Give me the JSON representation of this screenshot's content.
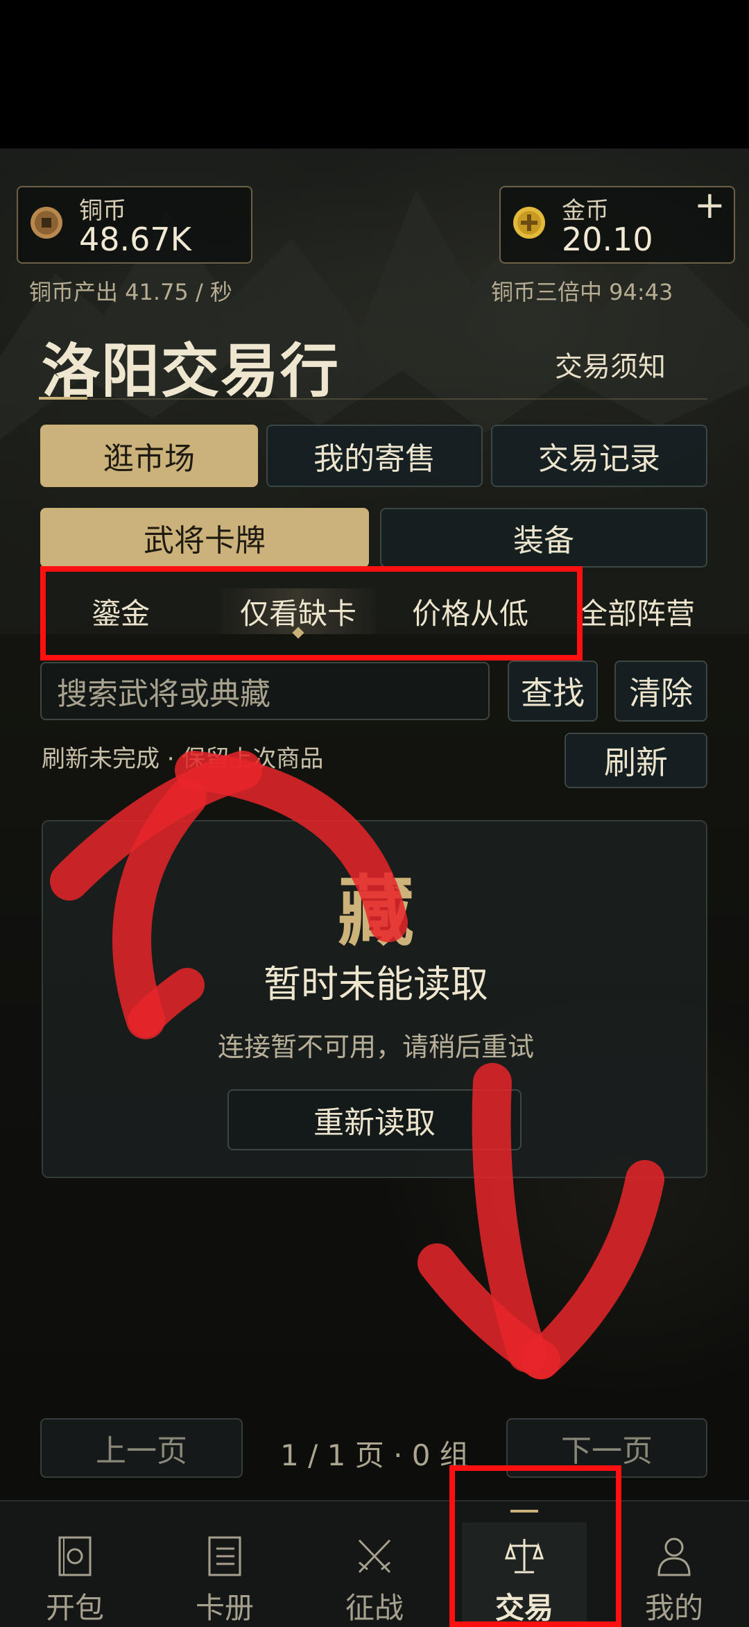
{
  "currency": {
    "copper": {
      "name": "铜币",
      "value": "48.67K",
      "rate": "铜币产出 41.75 / 秒"
    },
    "gold": {
      "name": "金币",
      "value": "20.10",
      "plus": "+",
      "status": "铜币三倍中 94:43"
    }
  },
  "header": {
    "title": "洛阳交易行",
    "notice_link": "交易须知"
  },
  "main_tabs": [
    "逛市场",
    "我的寄售",
    "交易记录"
  ],
  "category_tabs": [
    "武将卡牌",
    "装备"
  ],
  "filters": [
    "鎏金",
    "仅看缺卡",
    "价格从低",
    "全部阵营"
  ],
  "search": {
    "placeholder": "搜索武将或典藏",
    "find_label": "查找",
    "clear_label": "清除"
  },
  "refresh": {
    "status": "刷新未完成 · 保留上次商品",
    "label": "刷新"
  },
  "empty_state": {
    "glyph": "藏",
    "title": "暂时未能读取",
    "desc": "连接暂不可用，请稍后重试",
    "retry_label": "重新读取"
  },
  "pagination": {
    "prev": "上一页",
    "info": "1 / 1 页 · 0 组",
    "next": "下一页"
  },
  "nav": [
    {
      "label": "开包",
      "icon": "pack-icon"
    },
    {
      "label": "卡册",
      "icon": "album-icon"
    },
    {
      "label": "征战",
      "icon": "crossed-swords-icon"
    },
    {
      "label": "交易",
      "icon": "scale-icon"
    },
    {
      "label": "我的",
      "icon": "person-icon"
    }
  ],
  "colors": {
    "accent": "#cbb27a",
    "annotation_red": "#ff1010"
  }
}
